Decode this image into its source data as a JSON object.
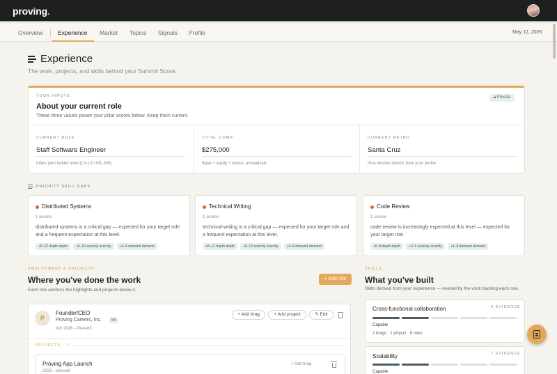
{
  "app": {
    "logo_text": "proving",
    "logo_dot": ".",
    "brand_color": "#e3a85a"
  },
  "nav": {
    "items": [
      "Overview",
      "Experience",
      "Market",
      "Topics",
      "Signals",
      "Profile"
    ],
    "active": "Experience",
    "date": "May 12, 2026"
  },
  "page": {
    "title": "Experience",
    "subtitle": "The work, projects, and skills behind your Summit Score."
  },
  "inputs": {
    "eyebrow": "YOUR INPUTS",
    "title": "About your current role",
    "desc": "These three values power your pillar scores below. Keep them current.",
    "badge": "Private",
    "fields": [
      {
        "label": "CURRENT ROLE",
        "value": "Staff Software Engineer",
        "hint": "Infers your ladder level (L3–L9 / M1–M5)"
      },
      {
        "label": "TOTAL COMP",
        "value": "$275,000",
        "hint": "Base + equity + bonus, annualized"
      },
      {
        "label": "CURRENT METRO",
        "value": "Santa Cruz",
        "hint": "Plus desired metros from your profile"
      }
    ]
  },
  "gaps": {
    "label": "PRIORITY SKILL GAPS",
    "items": [
      {
        "name": "Distributed Systems",
        "source": "1 source",
        "desc": "distributed-systems is a critical gap — expected for your target role and a frequent expectation at this level.",
        "chips": [
          "+8–12 depth depth",
          "+6–10 scarcity scarcity",
          "+4–8 demand demand"
        ]
      },
      {
        "name": "Technical Writing",
        "source": "1 source",
        "desc": "technical-writing is a critical gap — expected for your target role and a frequent expectation at this level.",
        "chips": [
          "+8–12 depth depth",
          "+6–10 scarcity scarcity",
          "+4–8 demand demand"
        ]
      },
      {
        "name": "Code Review",
        "source": "1 source",
        "desc": "code-review is increasingly expected at this level — expected for your target role.",
        "chips": [
          "+5–8 depth depth",
          "+3–6 scarcity scarcity",
          "+4–8 demand demand"
        ]
      }
    ]
  },
  "employment": {
    "eyebrow": "EMPLOYMENT & PROJECTS",
    "title": "Where you've done the work",
    "subtitle": "Each role anchors the highlights and projects below it.",
    "add_role": "+ Add role",
    "role": {
      "initial": "P",
      "title": "Founder/CEO",
      "company": "Proving Careers, Inc.",
      "level": "M5",
      "dates": "Apr 2026 – Present",
      "add_brag": "+ Add brag",
      "add_project": "+ Add project",
      "edit": "Edit",
      "projects_label": "PROJECTS · 1",
      "project": {
        "title": "Proving App Launch",
        "dates": "2026 – present",
        "add_brag": "+ Add brag"
      }
    }
  },
  "skills": {
    "eyebrow": "SKILLS",
    "title": "What you've built",
    "subtitle": "Skills derived from your experience — leveled by the work backing each one.",
    "items": [
      {
        "name": "Cross-functional collaboration",
        "evidence": "9 EVIDENCE",
        "level": "Capable",
        "level_value": 2,
        "level_max": 5,
        "meta": "2 brags · 1 project · 6 roles"
      },
      {
        "name": "Scalability",
        "evidence": "7 EVIDENCE",
        "level": "Capable",
        "level_value": 2,
        "level_max": 5,
        "meta": ""
      }
    ]
  }
}
